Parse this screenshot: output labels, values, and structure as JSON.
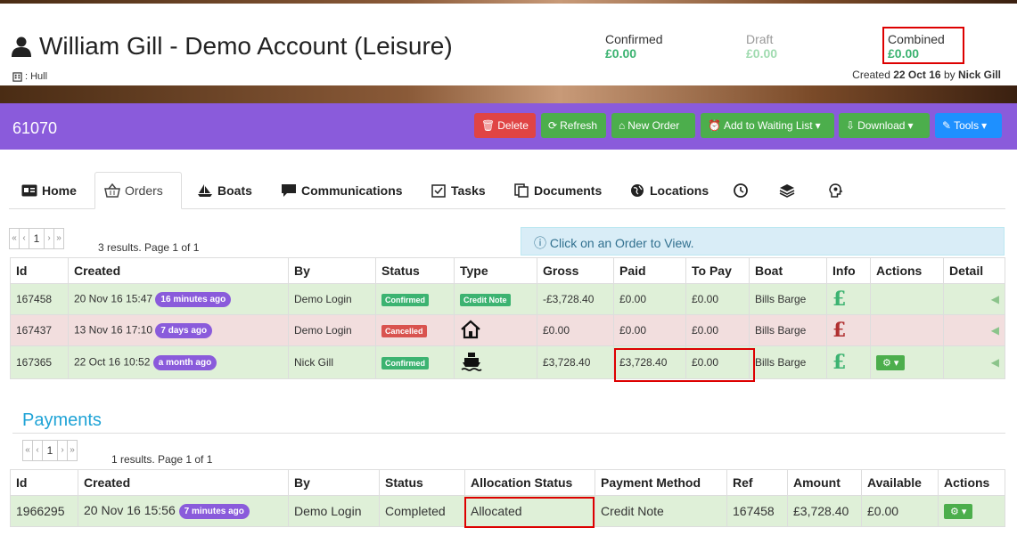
{
  "header": {
    "title": "William Gill - Demo Account (Leisure)",
    "location_label": ": Hull",
    "confirmed_label": "Confirmed",
    "confirmed_value": "£0.00",
    "draft_label": "Draft",
    "draft_value": "£0.00",
    "combined_label": "Combined",
    "combined_value": "£0.00",
    "created_prefix": "Created",
    "created_date": "22 Oct 16",
    "created_by_word": "by",
    "created_by": "Nick Gill"
  },
  "toolbar": {
    "account_id": "61070",
    "delete": "Delete",
    "refresh": "Refresh",
    "new_order": "New Order",
    "waiting_list": "Add to Waiting List",
    "download": "Download",
    "tools": "Tools"
  },
  "tabs": {
    "home": "Home",
    "orders": "Orders",
    "boats": "Boats",
    "communications": "Communications",
    "tasks": "Tasks",
    "documents": "Documents",
    "locations": "Locations"
  },
  "orders": {
    "pager": {
      "first": "«",
      "prev": "‹",
      "page": "1",
      "next": "›",
      "last": "»"
    },
    "page_info": "3 results. Page 1 of 1",
    "info_text": "Click on an Order to View.",
    "columns": [
      "Id",
      "Created",
      "By",
      "Status",
      "Type",
      "Gross",
      "Paid",
      "To Pay",
      "Boat",
      "Info",
      "Actions",
      "Detail"
    ],
    "rows": [
      {
        "id": "167458",
        "created": "20 Nov 16 15:47",
        "ago": "16 minutes ago",
        "by": "Demo Login",
        "status": "Confirmed",
        "type": "Credit Note",
        "gross": "-£3,728.40",
        "paid": "£0.00",
        "to_pay": "£0.00",
        "boat": "Bills Barge",
        "info": "£"
      },
      {
        "id": "167437",
        "created": "13 Nov 16 17:10",
        "ago": "7 days ago",
        "by": "Demo Login",
        "status": "Cancelled",
        "gross": "£0.00",
        "paid": "£0.00",
        "to_pay": "£0.00",
        "boat": "Bills Barge",
        "info": "£"
      },
      {
        "id": "167365",
        "created": "22 Oct 16 10:52",
        "ago": "a month ago",
        "by": "Nick Gill",
        "status": "Confirmed",
        "gross": "£3,728.40",
        "paid": "£3,728.40",
        "to_pay": "£0.00",
        "boat": "Bills Barge",
        "info": "£"
      }
    ]
  },
  "payments": {
    "title": "Payments",
    "pager": {
      "first": "«",
      "prev": "‹",
      "page": "1",
      "next": "›",
      "last": "»"
    },
    "page_info": "1 results. Page 1 of 1",
    "columns": [
      "Id",
      "Created",
      "By",
      "Status",
      "Allocation Status",
      "Payment Method",
      "Ref",
      "Amount",
      "Available",
      "Actions"
    ],
    "rows": [
      {
        "id": "1966295",
        "created": "20 Nov 16 15:56",
        "ago": "7 minutes ago",
        "by": "Demo Login",
        "status": "Completed",
        "allocation": "Allocated",
        "method": "Credit Note",
        "ref": "167458",
        "amount": "£3,728.40",
        "available": "£0.00"
      }
    ]
  },
  "colors": {
    "brand_purple": "#8a5bdb",
    "confirmed_green": "#3cb371",
    "cancelled_red": "#d9534f",
    "highlight": "#dd0000"
  },
  "icons": [
    "user-icon",
    "building-icon",
    "trash-icon",
    "refresh-icon",
    "basket-icon",
    "alarm-icon",
    "download-icon",
    "tools-icon",
    "id-card-icon",
    "boat-icon",
    "comments-icon",
    "tasks-icon",
    "documents-icon",
    "globe-icon",
    "clock-icon",
    "layers-icon",
    "head-icon",
    "house-icon",
    "ship-icon",
    "info-icon",
    "gear-icon",
    "chevron-circle-left-icon"
  ]
}
